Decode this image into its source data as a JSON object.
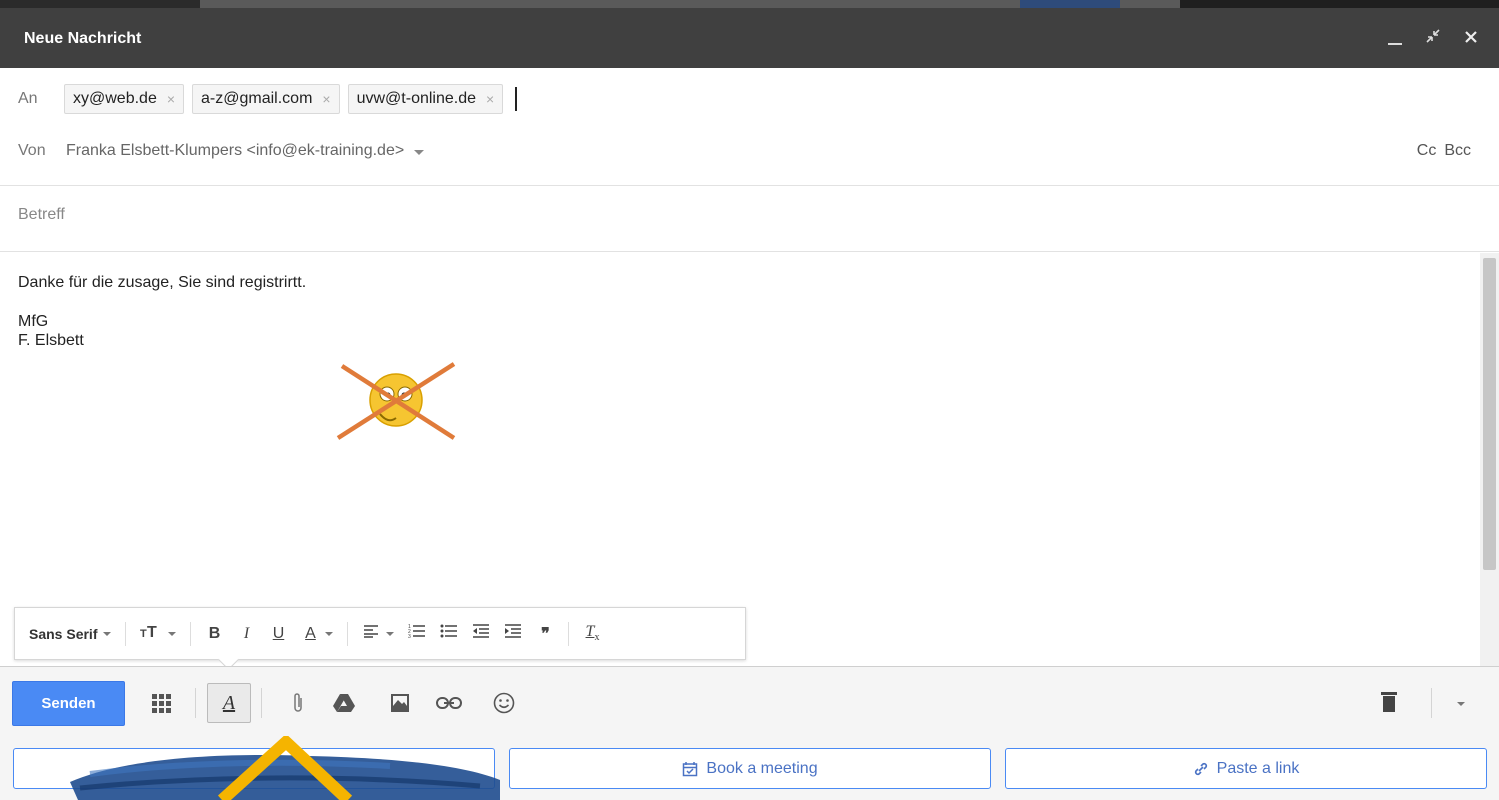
{
  "window": {
    "title": "Neue Nachricht"
  },
  "to_row": {
    "label": "An",
    "recipients": [
      "xy@web.de",
      "a-z@gmail.com",
      "uvw@t-online.de"
    ],
    "remove_glyph": "×"
  },
  "from_row": {
    "label": "Von",
    "value": "Franka Elsbett-Klumpers <info@ek-training.de>",
    "cc": "Cc",
    "bcc": "Bcc"
  },
  "subject": {
    "placeholder": "Betreff"
  },
  "body": {
    "line1": "Danke für die zusage, Sie sind registrirtt.",
    "line2": "MfG",
    "line3": "F. Elsbett"
  },
  "formatting": {
    "font": "Sans Serif",
    "icons": [
      "text-size-icon",
      "bold-icon",
      "italic-icon",
      "underline-icon",
      "text-color-icon",
      "align-icon",
      "numbered-list-icon",
      "bulleted-list-icon",
      "indent-less-icon",
      "indent-more-icon",
      "quote-icon",
      "remove-formatting-icon"
    ]
  },
  "toolbar": {
    "send_label": "Senden",
    "icons": [
      "apps-icon",
      "formatting-toggle-icon",
      "attach-icon",
      "drive-icon",
      "photo-icon",
      "link-icon",
      "emoji-icon",
      "trash-icon",
      "more-options-icon"
    ]
  },
  "lower_buttons": {
    "book": "Book a meeting",
    "paste": "Paste a link"
  },
  "colors": {
    "titlebar": "#404040",
    "send_button": "#4a8af4",
    "lower_button_border": "#4a8af4",
    "cross_mark": "#e07b3a",
    "arrow": "#f5b400"
  }
}
